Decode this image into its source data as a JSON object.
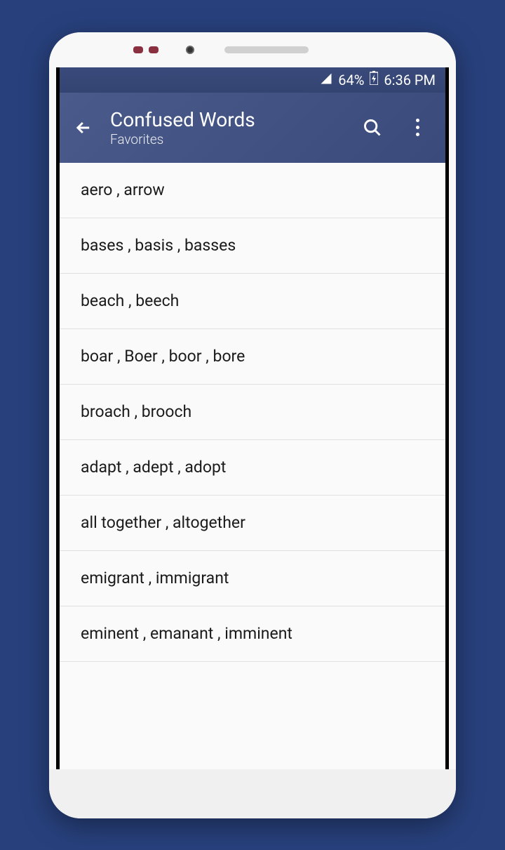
{
  "statusBar": {
    "battery": "64%",
    "time": "6:36 PM"
  },
  "appBar": {
    "title": "Confused Words",
    "subtitle": "Favorites"
  },
  "listItems": [
    "aero , arrow",
    "bases , basis , basses",
    "beach , beech",
    "boar , Boer , boor , bore",
    "broach , brooch",
    "adapt , adept , adopt",
    "all together , altogether",
    "emigrant , immigrant",
    "eminent , emanant , imminent"
  ]
}
